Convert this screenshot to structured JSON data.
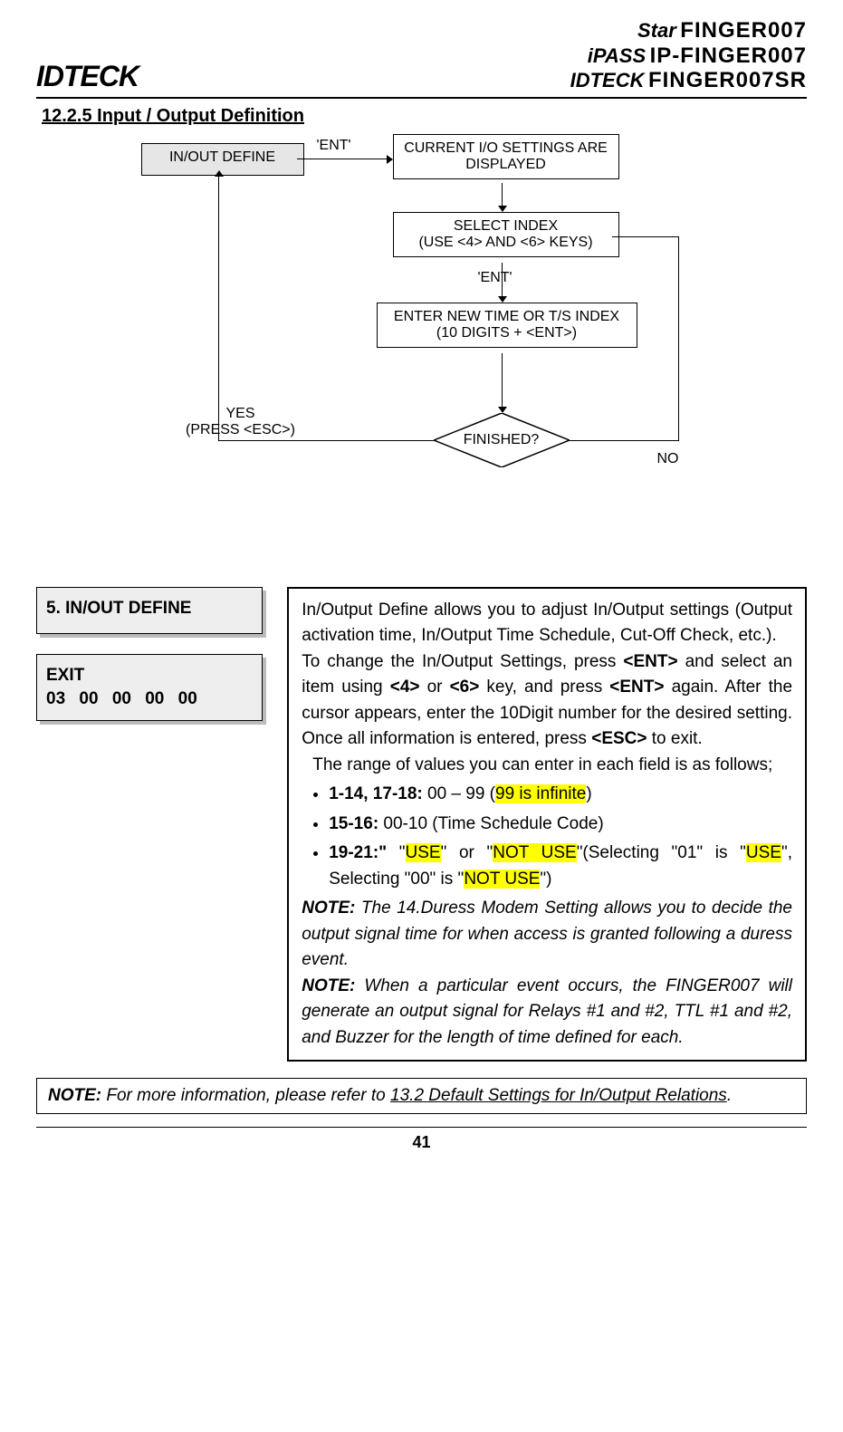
{
  "header": {
    "logo_left": "IDTECK",
    "brands": [
      {
        "prefix": "Star",
        "name": "FINGER007"
      },
      {
        "prefix": "iPASS",
        "name": "IP-FINGER007"
      },
      {
        "prefix": "IDTECK",
        "name": "FINGER007SR"
      }
    ]
  },
  "section_title": "12.2.5 Input / Output Definition",
  "flow": {
    "box_in_out": "IN/OUT DEFINE",
    "ent1": "'ENT'",
    "box_current": "CURRENT I/O SETTINGS ARE DISPLAYED",
    "box_select_l1": "SELECT INDEX",
    "box_select_l2": "(USE <4> AND <6> KEYS)",
    "ent2": "'ENT'",
    "box_enter_l1": "ENTER NEW TIME OR T/S INDEX",
    "box_enter_l2": "(10 DIGITS + <ENT>)",
    "diamond": "FINISHED?",
    "yes_l1": "YES",
    "yes_l2": "(PRESS <ESC>)",
    "no": "NO"
  },
  "lcd1_line1": "5. IN/OUT DEFINE",
  "lcd2_line1": "EXIT",
  "lcd2_line2": "03  00  00  00  00",
  "explain": {
    "p1": "In/Output Define allows you to adjust In/Output settings (Output activation time, In/Output Time Schedule, Cut-Off Check, etc.).",
    "p2a": "To change the In/Output Settings, press ",
    "p2_ent": "<ENT>",
    "p2b": " and select an item using ",
    "p2_4": "<4>",
    "p2c": " or ",
    "p2_6": "<6>",
    "p2d": " key, and press ",
    "p2_ent2": "<ENT>",
    "p2e": " again. After the cursor appears, enter the 10Digit number for the desired setting. Once all information is entered, press ",
    "p2_esc": "<ESC>",
    "p2f": " to exit.",
    "p3": "The range of values you can enter in each field is as follows;",
    "b1a": "1-14, 17-18:",
    "b1b": " 00 – 99 (",
    "b1_hl": "99 is infinite",
    "b1c": ")",
    "b2a": "15-16:",
    "b2b": " 00-10 (Time Schedule Code)",
    "b3a": "19-21:\"",
    "b3b": " \"",
    "b3_use": "USE",
    "b3c": "\" or \"",
    "b3_notuse": "NOT USE",
    "b3d": "\"(Selecting \"01\" is \"",
    "b3_use2": "USE",
    "b3e": "\", Selecting \"00\" is \"",
    "b3_notuse2": "NOT USE",
    "b3f": "\")",
    "note1_label": "NOTE:",
    "note1": " The 14.Duress Modem Setting allows you to decide the output signal time for when access is granted following a duress event.",
    "note2_label": "NOTE:",
    "note2": " When a particular event occurs, the FINGER007 will generate an output signal for Relays #1 and #2, TTL #1 and #2, and Buzzer for the length of time defined for each."
  },
  "bottom_note_label": "NOTE:",
  "bottom_note_a": " For more information, please refer to ",
  "bottom_note_link": "13.2 Default Settings for In/Output Relations",
  "bottom_note_b": ".",
  "page_number": "41"
}
